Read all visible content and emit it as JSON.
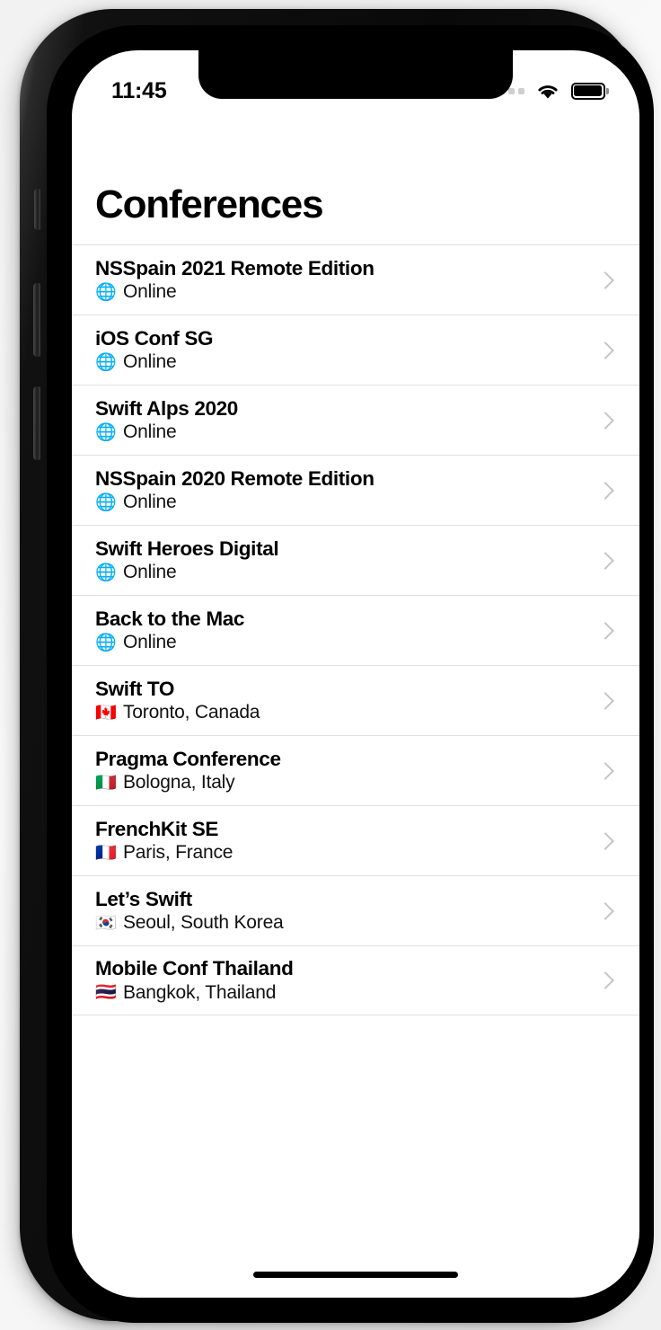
{
  "status_bar": {
    "time": "11:45",
    "signal_icon": "signal-dots-icon",
    "wifi_icon": "wifi-icon",
    "battery_icon": "battery-full-icon"
  },
  "header": {
    "title": "Conferences"
  },
  "list": {
    "items": [
      {
        "name": "NSSpain 2021 Remote Edition",
        "flag": "🌐",
        "location": "Online",
        "chevron": "chevron-right-icon"
      },
      {
        "name": "iOS Conf SG",
        "flag": "🌐",
        "location": "Online",
        "chevron": "chevron-right-icon"
      },
      {
        "name": "Swift Alps 2020",
        "flag": "🌐",
        "location": "Online",
        "chevron": "chevron-right-icon"
      },
      {
        "name": "NSSpain 2020 Remote Edition",
        "flag": "🌐",
        "location": "Online",
        "chevron": "chevron-right-icon"
      },
      {
        "name": "Swift Heroes Digital",
        "flag": "🌐",
        "location": "Online",
        "chevron": "chevron-right-icon"
      },
      {
        "name": "Back to the Mac",
        "flag": "🌐",
        "location": "Online",
        "chevron": "chevron-right-icon"
      },
      {
        "name": "Swift TO",
        "flag": "🇨🇦",
        "location": "Toronto, Canada",
        "chevron": "chevron-right-icon"
      },
      {
        "name": "Pragma Conference",
        "flag": "🇮🇹",
        "location": "Bologna, Italy",
        "chevron": "chevron-right-icon"
      },
      {
        "name": "FrenchKit SE",
        "flag": "🇫🇷",
        "location": "Paris, France",
        "chevron": "chevron-right-icon"
      },
      {
        "name": "Let’s Swift",
        "flag": "🇰🇷",
        "location": "Seoul, South Korea",
        "chevron": "chevron-right-icon"
      },
      {
        "name": "Mobile Conf Thailand",
        "flag": "🇹🇭",
        "location": "Bangkok, Thailand",
        "chevron": "chevron-right-icon"
      }
    ]
  },
  "colors": {
    "background": "#ffffff",
    "title_text": "#000000",
    "separator": "#e0e0e2",
    "chevron": "#c5c5c7",
    "status_signal_inactive": "#cfcfd2"
  }
}
